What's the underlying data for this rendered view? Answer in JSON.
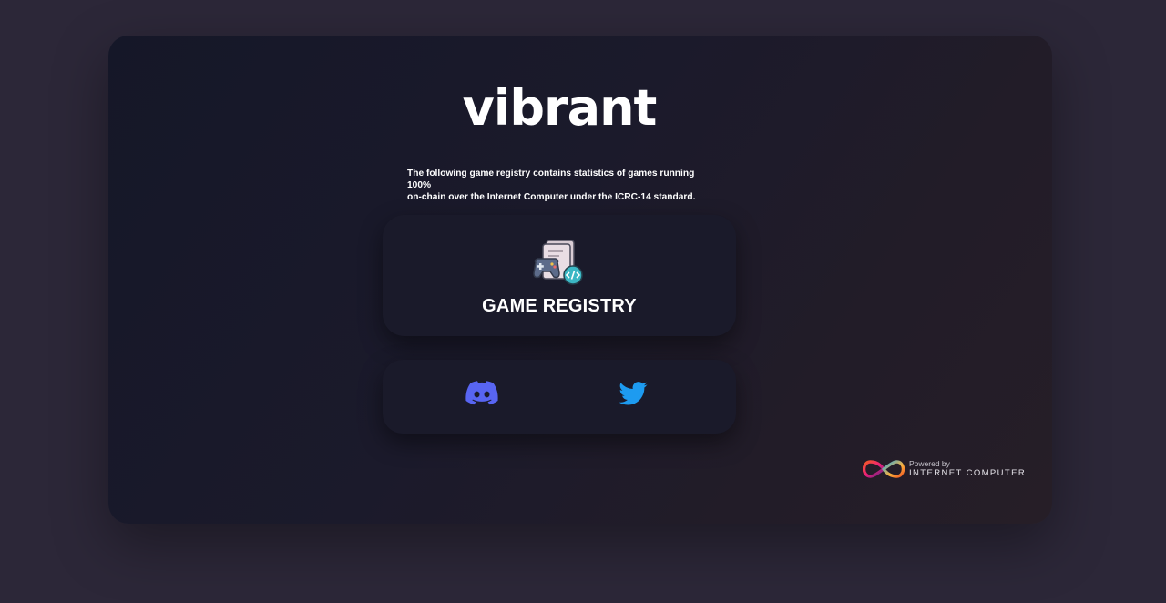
{
  "header": {
    "brand": "vibrant"
  },
  "intro": {
    "line1": "The following game registry contains statistics of games running 100%",
    "line2": "on-chain over the Internet Computer under the ICRC-14 standard."
  },
  "registry_card": {
    "label": "GAME REGISTRY",
    "icon": "game-registry-icon"
  },
  "social": {
    "discord_icon": "discord-icon",
    "twitter_icon": "twitter-icon",
    "discord_color": "#5865f2",
    "twitter_color": "#1d9bf0"
  },
  "footer": {
    "powered_by": "Powered by",
    "platform": "INTERNET COMPUTER",
    "logo_icon": "internet-computer-logo-icon"
  },
  "colors": {
    "page_bg": "#2c2738",
    "card_bg": "#1a1a2a",
    "text": "#ffffff"
  }
}
